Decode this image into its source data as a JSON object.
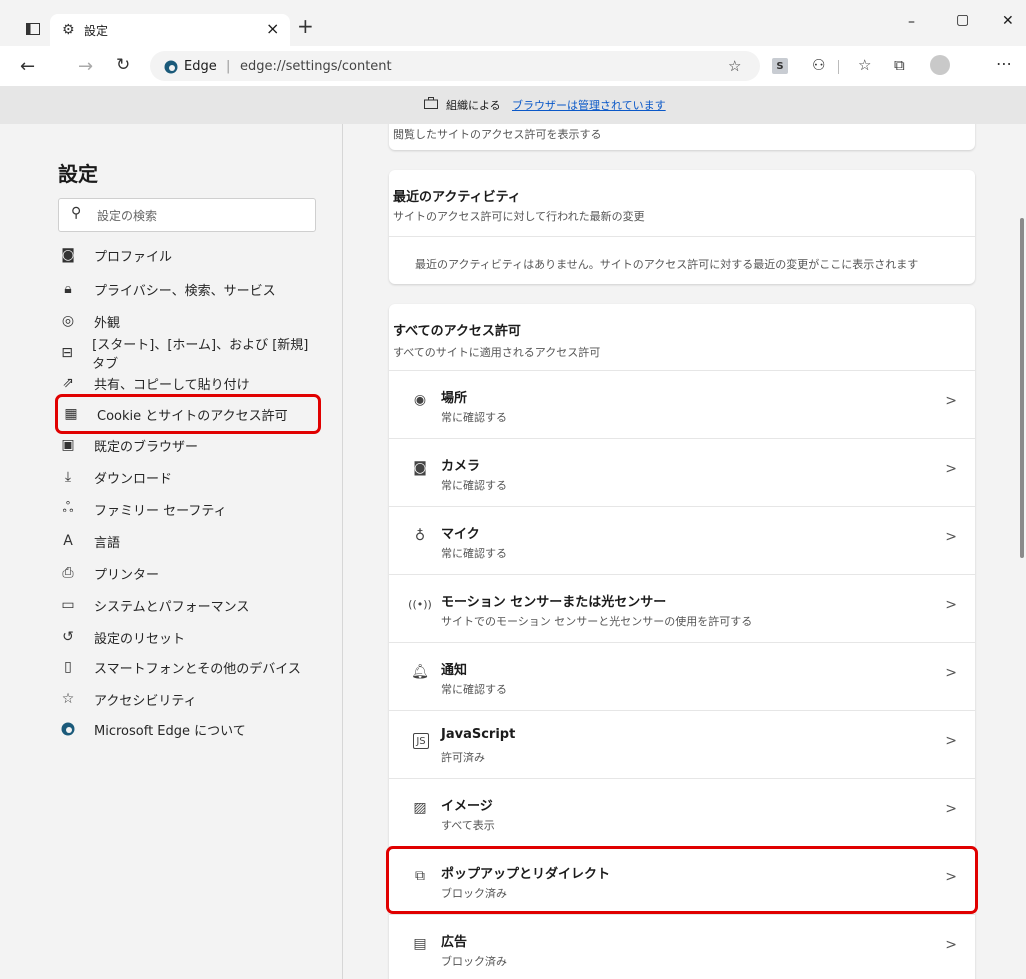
{
  "browser": {
    "tab_title": "設定",
    "tab_close": "×",
    "new_tab": "+",
    "address_label": "Edge",
    "address_url": "edge://settings/content",
    "win_min": "–",
    "win_max": "▢",
    "win_close": "✕"
  },
  "managed_banner": {
    "prefix": "組織による",
    "link": "ブラウザーは管理されています"
  },
  "sidebar": {
    "title": "設定",
    "search_placeholder": "設定の検索",
    "items": [
      {
        "label": "プロファイル"
      },
      {
        "label": "プライバシー、検索、サービス"
      },
      {
        "label": "外観"
      },
      {
        "label": "[スタート]、[ホーム]、および [新規] タブ"
      },
      {
        "label": "共有、コピーして貼り付け"
      },
      {
        "label": "Cookie とサイトのアクセス許可"
      },
      {
        "label": "既定のブラウザー"
      },
      {
        "label": "ダウンロード"
      },
      {
        "label": "ファミリー セーフティ"
      },
      {
        "label": "言語"
      },
      {
        "label": "プリンター"
      },
      {
        "label": "システムとパフォーマンス"
      },
      {
        "label": "設定のリセット"
      },
      {
        "label": "スマートフォンとその他のデバイス"
      },
      {
        "label": "アクセシビリティ"
      },
      {
        "label": "Microsoft Edge について"
      }
    ]
  },
  "main": {
    "top_card_text": "閲覧したサイトのアクセス許可を表示する",
    "recent": {
      "title": "最近のアクティビティ",
      "subtitle": "サイトのアクセス許可に対して行われた最新の変更",
      "empty": "最近のアクティビティはありません。サイトのアクセス許可に対する最近の変更がここに表示されます"
    },
    "all": {
      "title": "すべてのアクセス許可",
      "subtitle": "すべてのサイトに適用されるアクセス許可",
      "rows": [
        {
          "title": "場所",
          "sub": "常に確認する"
        },
        {
          "title": "カメラ",
          "sub": "常に確認する"
        },
        {
          "title": "マイク",
          "sub": "常に確認する"
        },
        {
          "title": "モーション センサーまたは光センサー",
          "sub": "サイトでのモーション センサーと光センサーの使用を許可する"
        },
        {
          "title": "通知",
          "sub": "常に確認する"
        },
        {
          "title": "JavaScript",
          "sub": "許可済み"
        },
        {
          "title": "イメージ",
          "sub": "すべて表示"
        },
        {
          "title": "ポップアップとリダイレクト",
          "sub": "ブロック済み"
        },
        {
          "title": "広告",
          "sub": "ブロック済み"
        }
      ]
    }
  },
  "colors": {
    "highlight": "#e00000",
    "link": "#0a58c8"
  }
}
